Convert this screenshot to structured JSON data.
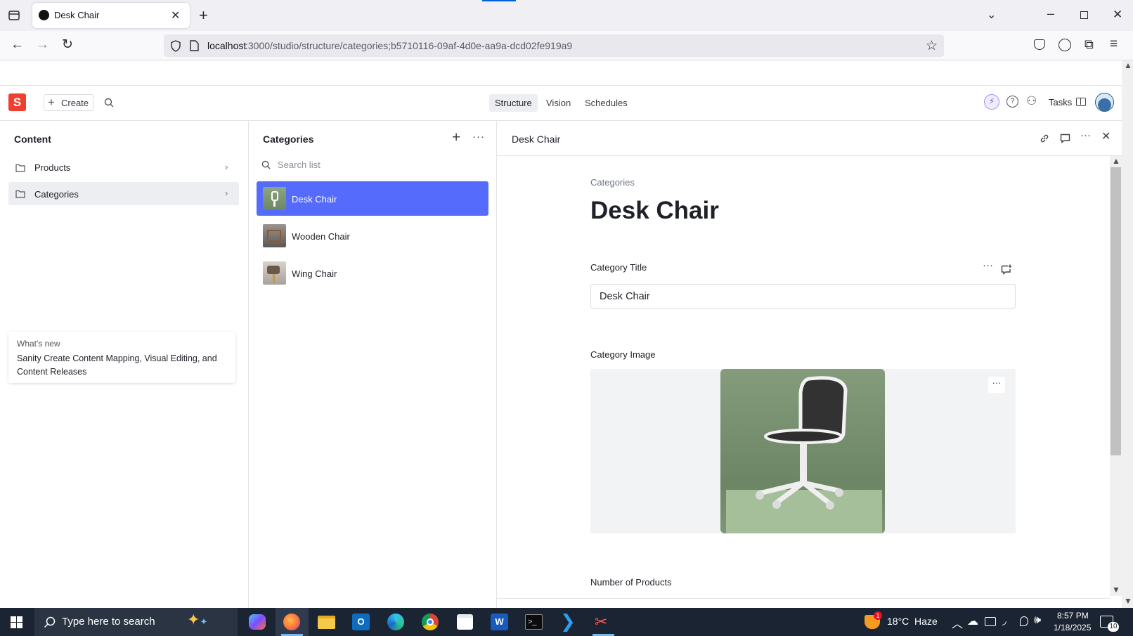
{
  "browser": {
    "tab_title": "Desk Chair",
    "url_host": "localhost",
    "url_rest": ":3000/studio/structure/categories;b5710116-09af-4d0e-aa9a-dcd02fe919a9"
  },
  "studio": {
    "logo_letter": "S",
    "create_label": "Create",
    "nav_tabs": [
      "Structure",
      "Vision",
      "Schedules"
    ],
    "active_tab": "Structure",
    "tasks_label": "Tasks"
  },
  "content_pane": {
    "title": "Content",
    "items": [
      {
        "label": "Products"
      },
      {
        "label": "Categories"
      }
    ]
  },
  "whats_new": {
    "heading": "What's new",
    "body": "Sanity Create Content Mapping, Visual Editing, and Content Releases"
  },
  "categories_pane": {
    "title": "Categories",
    "search_placeholder": "Search list",
    "items": [
      {
        "label": "Desk Chair"
      },
      {
        "label": "Wooden Chair"
      },
      {
        "label": "Wing Chair"
      }
    ]
  },
  "document": {
    "pane_title": "Desk Chair",
    "type_label": "Categories",
    "heading": "Desk Chair",
    "fields": {
      "title_label": "Category Title",
      "title_value": "Desk Chair",
      "image_label": "Category Image",
      "products_label": "Number of Products"
    }
  },
  "taskbar": {
    "search_placeholder": "Type here to search",
    "weather": "18°C  Haze",
    "time": "8:57 PM",
    "date": "1/18/2025",
    "notification_count": "10",
    "weather_badge": "1"
  },
  "colors": {
    "accent": "#556bfc",
    "sanity_red": "#f03e2f",
    "taskbar": "#1b2432"
  }
}
